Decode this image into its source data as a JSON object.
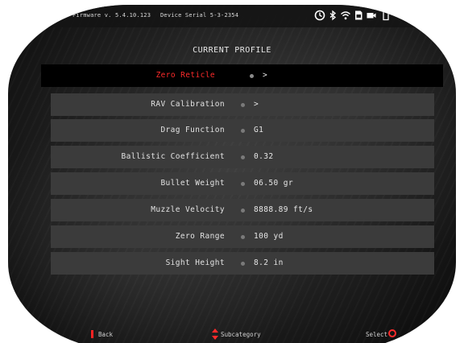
{
  "status_bar": {
    "firmware": "Firmware v. 5.4.10.123",
    "serial": "Device Serial 5-3-2354",
    "icons": [
      "timer-icon",
      "bluetooth-icon",
      "wifi-icon",
      "sd-card-icon",
      "video-record-icon",
      "battery-icon"
    ]
  },
  "title": "CURRENT PROFILE",
  "menu": {
    "items": [
      {
        "label": "Zero Reticle",
        "value": ">"
      },
      {
        "label": "RAV Calibration",
        "value": ">"
      },
      {
        "label": "Drag Function",
        "value": "G1"
      },
      {
        "label": "Ballistic Coefficient",
        "value": "0.32"
      },
      {
        "label": "Bullet Weight",
        "value": "06.50 gr"
      },
      {
        "label": "Muzzle Velocity",
        "value": "8888.89 ft/s"
      },
      {
        "label": "Zero Range",
        "value": "100 yd"
      },
      {
        "label": "Sight Height",
        "value": "8.2 in"
      }
    ],
    "selected_index": 0
  },
  "bottom_bar": {
    "back": "Back",
    "subcategory": "Subcategory",
    "select": "Select"
  },
  "colors": {
    "accent": "#ff2b2b",
    "row_bg": "#3b3b3b",
    "selected_bg": "#000000",
    "text": "#e2e2e2"
  }
}
